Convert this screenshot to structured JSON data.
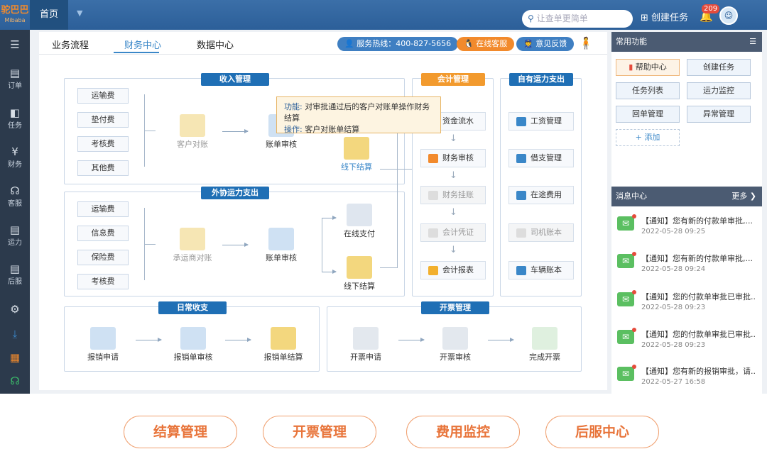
{
  "header": {
    "logo": "驼巴巴",
    "logo_sub": "Mibaba",
    "home_tab": "首页",
    "search_placeholder": "让查单更简单",
    "create_task": "创建任务",
    "notice_count": "209"
  },
  "sidebar": [
    {
      "icon": "menu-icon",
      "label": ""
    },
    {
      "icon": "order-icon",
      "label": "订单"
    },
    {
      "icon": "task-icon",
      "label": "任务"
    },
    {
      "icon": "finance-icon",
      "label": "财务"
    },
    {
      "icon": "service-icon",
      "label": "客服"
    },
    {
      "icon": "transport-icon",
      "label": "运力"
    },
    {
      "icon": "after-icon",
      "label": "后服"
    },
    {
      "icon": "settings-icon",
      "label": ""
    },
    {
      "icon": "download-icon",
      "label": ""
    },
    {
      "icon": "grid-icon",
      "label": ""
    },
    {
      "icon": "headset-icon",
      "label": ""
    }
  ],
  "tabs": [
    "业务流程",
    "财务中心",
    "数据中心"
  ],
  "service": {
    "hotline": "服务热线：400-827-5656",
    "online": "在线客服",
    "feedback": "意见反馈"
  },
  "income": {
    "title": "收入管理",
    "fees": [
      "运输费",
      "垫付费",
      "考核费",
      "其他费"
    ],
    "node1": "客户对账",
    "node2": "账单审核",
    "node3": "线下结算"
  },
  "outsource": {
    "title": "外协运力支出",
    "fees": [
      "运输费",
      "信息费",
      "保险费",
      "考核费"
    ],
    "node1": "承运商对账",
    "node2": "账单审核",
    "node3a": "在线支付",
    "node3b": "线下结算"
  },
  "accounting": {
    "title": "会计管理",
    "items": [
      "资金流水",
      "财务审核",
      "财务挂账",
      "会计凭证",
      "会计报表"
    ]
  },
  "own": {
    "title": "自有运力支出",
    "items": [
      "工资管理",
      "借支管理",
      "在途费用",
      "司机账本",
      "车辆账本"
    ]
  },
  "daily": {
    "title": "日常收支",
    "items": [
      "报销申请",
      "报销单审核",
      "报销单结算"
    ]
  },
  "invoice": {
    "title": "开票管理",
    "items": [
      "开票申请",
      "开票审核",
      "完成开票"
    ]
  },
  "tooltip": {
    "func_label": "功能:",
    "func": "对审批通过后的客户对账单操作财务结算",
    "op_label": "操作:",
    "op": "客户对账单结算"
  },
  "quick": {
    "title": "常用功能",
    "items": [
      "帮助中心",
      "创建任务",
      "任务列表",
      "运力监控",
      "回单管理",
      "异常管理"
    ],
    "add": "+ 添加"
  },
  "messages": {
    "title": "消息中心",
    "more": "更多",
    "items": [
      {
        "text": "【通知】您有新的付款单审批,...",
        "date": "2022-05-28 09:25"
      },
      {
        "text": "【通知】您有新的付款单审批,...",
        "date": "2022-05-28 09:24"
      },
      {
        "text": "【通知】您的付款单审批已审批...",
        "date": "2022-05-28 09:23"
      },
      {
        "text": "【通知】您的付款单审批已审批...",
        "date": "2022-05-28 09:23"
      },
      {
        "text": "【通知】您有新的报销审批，请...",
        "date": "2022-05-27 16:58"
      }
    ]
  },
  "bottom_buttons": [
    "结算管理",
    "开票管理",
    "费用监控",
    "后服中心"
  ]
}
